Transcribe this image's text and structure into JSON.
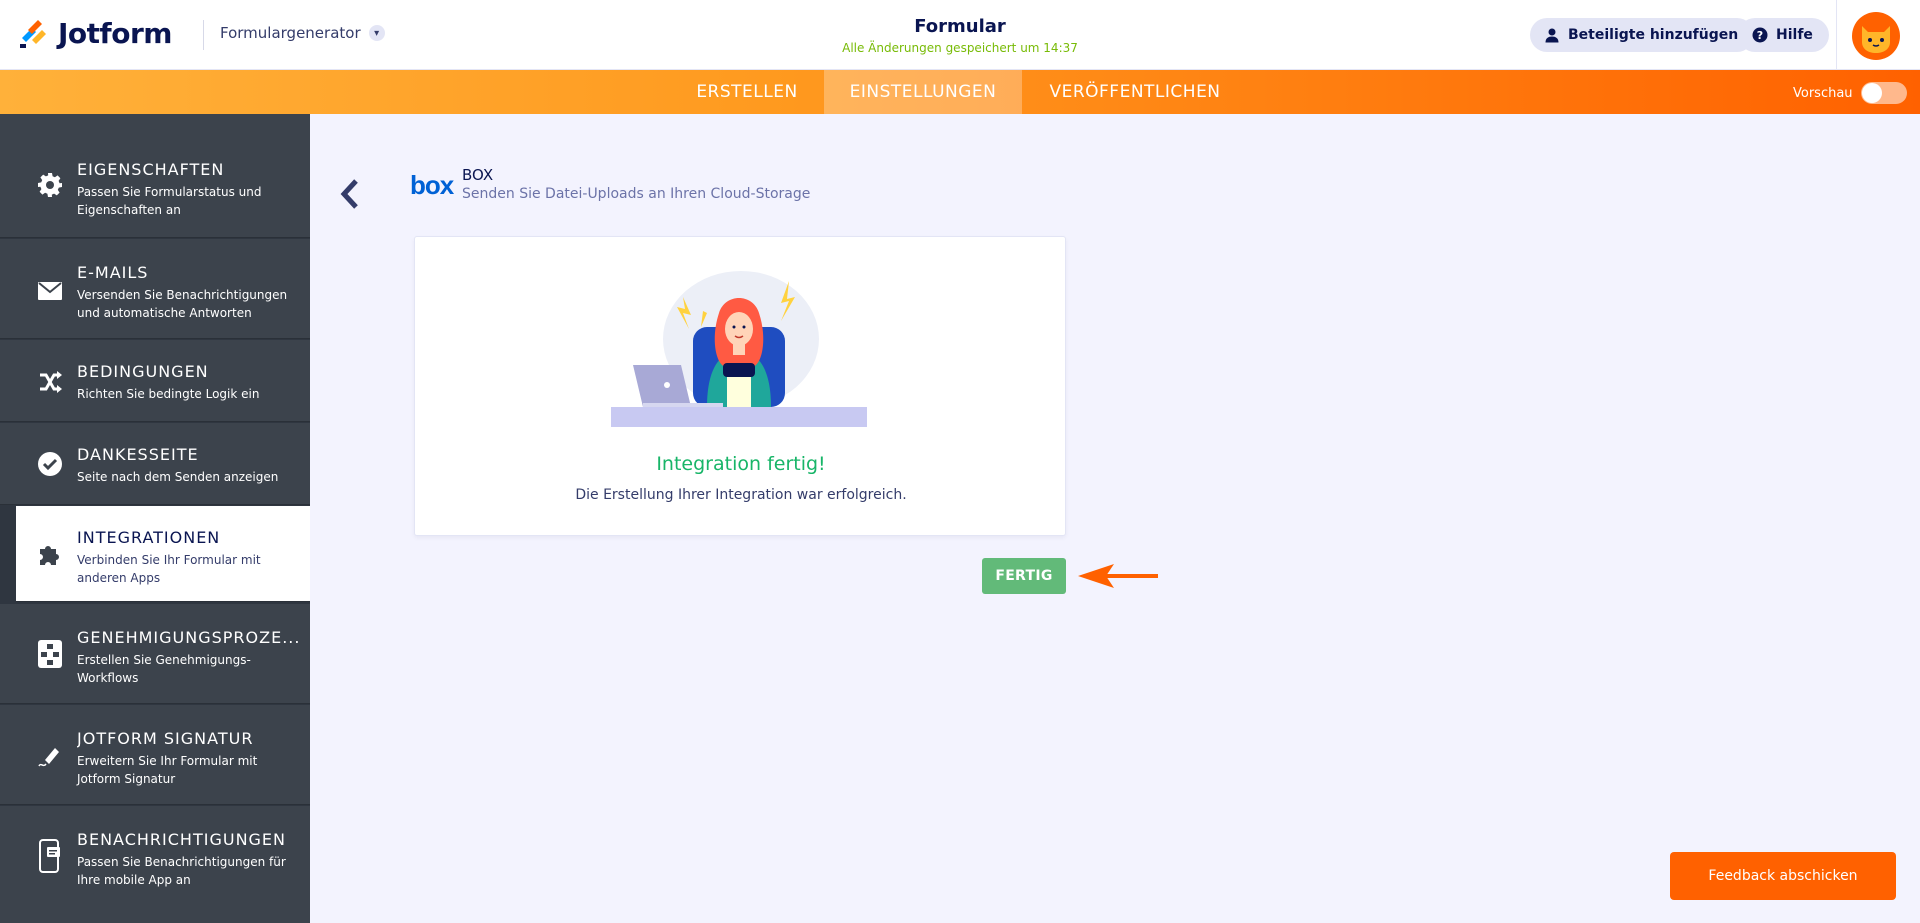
{
  "brand": {
    "name": "Jotform"
  },
  "header": {
    "generator_label": "Formulargenerator",
    "form_title": "Formular",
    "save_status": "Alle Änderungen gespeichert um 14:37",
    "add_participants": "Beteiligte hinzufügen",
    "help": "Hilfe"
  },
  "nav": {
    "tabs": [
      "ERSTELLEN",
      "EINSTELLUNGEN",
      "VERÖFFENTLICHEN"
    ],
    "active_tab": "EINSTELLUNGEN",
    "preview_label": "Vorschau",
    "preview_on": false
  },
  "sidebar": {
    "items": [
      {
        "title": "EIGENSCHAFTEN",
        "desc": "Passen Sie Formularstatus und Eigenschaften an",
        "icon": "gear-icon"
      },
      {
        "title": "E-MAILS",
        "desc": "Versenden Sie Benachrichtigungen und automatische Antworten",
        "icon": "envelope-icon"
      },
      {
        "title": "BEDINGUNGEN",
        "desc": "Richten Sie bedingte Logik ein",
        "icon": "shuffle-icon"
      },
      {
        "title": "DANKESSEITE",
        "desc": "Seite nach dem Senden anzeigen",
        "icon": "check-circle-icon"
      },
      {
        "title": "INTEGRATIONEN",
        "desc": "Verbinden Sie Ihr Formular mit anderen Apps",
        "icon": "puzzle-icon",
        "active": true
      },
      {
        "title": "GENEHMIGUNGSPROZE...",
        "desc": "Erstellen Sie Genehmigungs-Workflows",
        "icon": "workflow-icon"
      },
      {
        "title": "JOTFORM SIGNATUR",
        "desc": "Erweitern Sie Ihr Formular mit Jotform Signatur",
        "icon": "pen-icon"
      },
      {
        "title": "BENACHRICHTIGUNGEN",
        "desc": "Passen Sie Benachrichtigungen für Ihre mobile App an",
        "icon": "mobile-icon"
      }
    ]
  },
  "integration": {
    "logo_text": "box",
    "name": "BOX",
    "desc": "Senden Sie Datei-Uploads an Ihren Cloud-Storage"
  },
  "result": {
    "title": "Integration fertig!",
    "desc": "Die Erstellung Ihrer Integration war erfolgreich.",
    "done_button": "FERTIG"
  },
  "feedback": {
    "label": "Feedback abschicken"
  },
  "colors": {
    "orange": "#ff6100",
    "success": "#18b568",
    "done_button": "#62ba79",
    "sidebar": "#3c434c"
  }
}
